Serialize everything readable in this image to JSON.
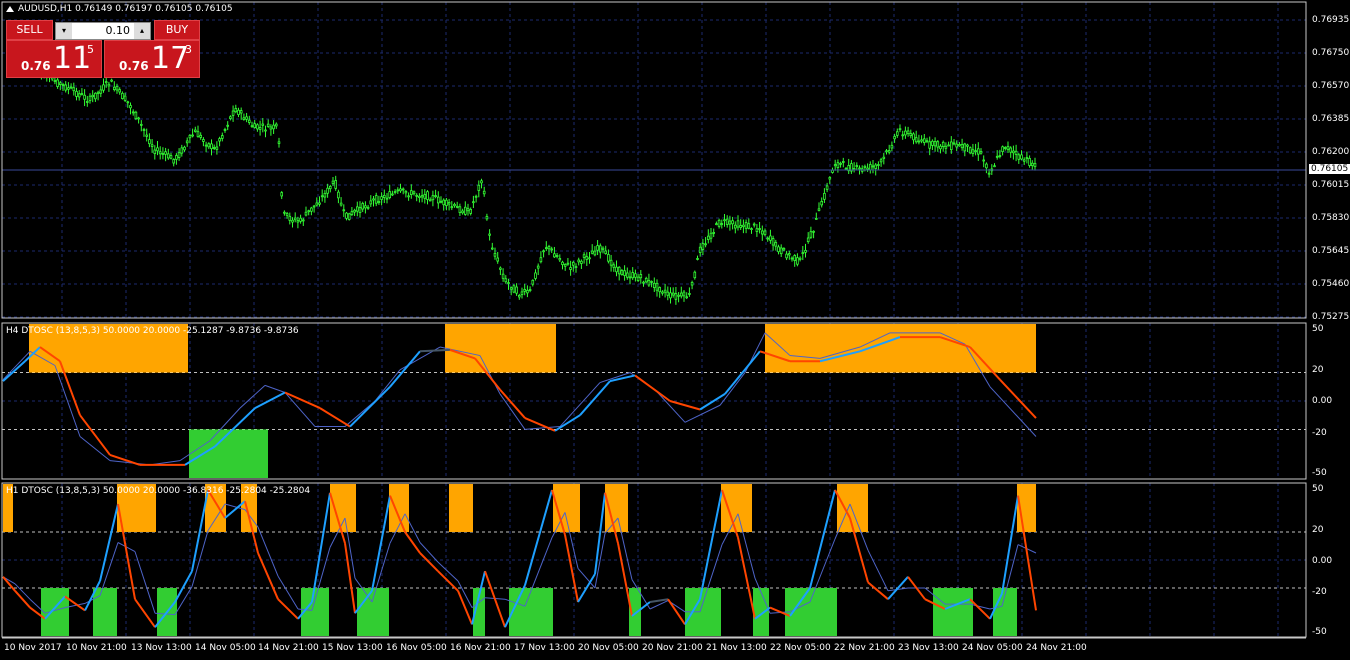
{
  "window": {
    "symbol_info": "AUDUSD,H1  0.76149 0.76197 0.76105 0.76105"
  },
  "trade_panel": {
    "sell_label": "SELL",
    "buy_label": "BUY",
    "lot_value": "0.10",
    "sell_price_small": "0.76",
    "sell_price_big": "11",
    "sell_price_sup": "5",
    "buy_price_small": "0.76",
    "buy_price_big": "17",
    "buy_price_sup": "3"
  },
  "main_axis": {
    "ticks": [
      "0.76935",
      "0.76750",
      "0.76570",
      "0.76385",
      "0.76200",
      "0.76015",
      "0.75830",
      "0.75645",
      "0.75460",
      "0.75275"
    ],
    "current_price": "0.76105"
  },
  "indicator_h4": {
    "label": "H4 DTOSC (13,8,5,3) 50.0000 20.0000 -25.1287 -9.8736 -9.8736",
    "ticks": [
      "50",
      "20",
      "0.00",
      "-20",
      "-50"
    ]
  },
  "indicator_h1": {
    "label": "H1 DTOSC (13,8,5,3) 50.0000 20.0000 -36.8316 -25.2804 -25.2804",
    "ticks": [
      "50",
      "20",
      "0.00",
      "-20",
      "-50"
    ]
  },
  "time_axis": {
    "labels": [
      "10 Nov 2017",
      "10 Nov 21:00",
      "13 Nov 13:00",
      "14 Nov 05:00",
      "14 Nov 21:00",
      "15 Nov 13:00",
      "16 Nov 05:00",
      "16 Nov 21:00",
      "17 Nov 13:00",
      "20 Nov 05:00",
      "20 Nov 21:00",
      "21 Nov 13:00",
      "22 Nov 05:00",
      "22 Nov 21:00",
      "23 Nov 13:00",
      "24 Nov 05:00",
      "24 Nov 21:00"
    ]
  },
  "colors": {
    "candle": "#33ff33",
    "grid": "#1c2a6e",
    "overbought": "#ffa500",
    "oversold": "#32cd32",
    "line_up": "#1ea0ff",
    "line_down": "#ff4500",
    "signal": "#4e64c8"
  }
}
